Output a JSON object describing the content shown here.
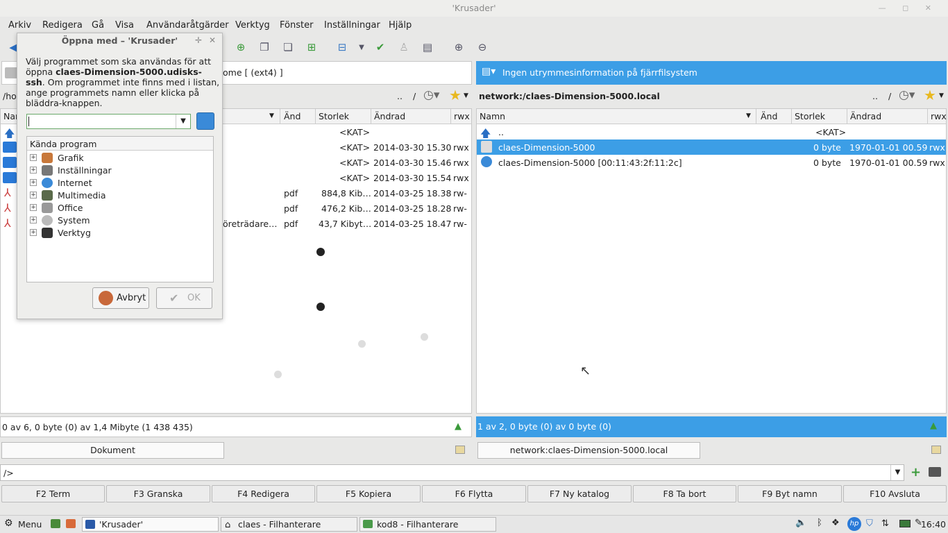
{
  "window": {
    "title": "'Krusader'"
  },
  "menu": [
    "Arkiv",
    "Redigera",
    "Gå",
    "Visa",
    "Användaråtgärder",
    "Verktyg",
    "Fönster",
    "Inställningar",
    "Hjälp"
  ],
  "left": {
    "path": "/ho",
    "disk_info": "ome [ (ext4) ]",
    "nav_up": "..",
    "nav_root": "/",
    "cols": {
      "name": "Nan",
      "ext": "Änd",
      "size": "Storlek",
      "date": "Ändrad",
      "perm": "rwx"
    },
    "rows": [
      {
        "name": "",
        "ext": "",
        "size": "<KAT>",
        "date": "",
        "perm": ""
      },
      {
        "name": "",
        "ext": "",
        "size": "<KAT>",
        "date": "2014-03-30 15.30",
        "perm": "rwx"
      },
      {
        "name": "",
        "ext": "",
        "size": "<KAT>",
        "date": "2014-03-30 15.46",
        "perm": "rwx"
      },
      {
        "name": "",
        "ext": "",
        "size": "<KAT>",
        "date": "2014-03-30 15.54",
        "perm": "rwx"
      },
      {
        "name": "",
        "ext": "pdf",
        "size": "884,8 Kib…",
        "date": "2014-03-25 18.38",
        "perm": "rw-"
      },
      {
        "name": "",
        "ext": "pdf",
        "size": "476,2 Kib…",
        "date": "2014-03-25 18.28",
        "perm": "rw-"
      },
      {
        "name": "öreträdare…",
        "ext": "pdf",
        "size": "43,7 Kibyt…",
        "date": "2014-03-25 18.47",
        "perm": "rw-"
      }
    ],
    "status": "0 av 6, 0 byte (0) av 1,4 Mibyte (1 438 435)",
    "tab": "Dokument"
  },
  "right": {
    "disk_info": "Ingen utrymmesinformation på fjärrfilsystem",
    "path": "network:/claes-Dimension-5000.local",
    "nav_up": "..",
    "nav_root": "/",
    "cols": {
      "name": "Namn",
      "ext": "Änd",
      "size": "Storlek",
      "date": "Ändrad",
      "perm": "rwx"
    },
    "rows": [
      {
        "name": "..",
        "size": "<KAT>",
        "date": "",
        "perm": ""
      },
      {
        "name": "claes-Dimension-5000",
        "size": "0 byte",
        "date": "1970-01-01 00.59",
        "perm": "rwx"
      },
      {
        "name": "claes-Dimension-5000 [00:11:43:2f:11:2c]",
        "size": "0 byte",
        "date": "1970-01-01 00.59",
        "perm": "rwx"
      }
    ],
    "status": "1 av 2, 0 byte (0) av 0 byte (0)",
    "tab": "network:claes-Dimension-5000.local"
  },
  "cmdline": {
    "value": "/>"
  },
  "fkeys": [
    "F2  Term",
    "F3 Granska",
    "F4 Redigera",
    "F5 Kopiera",
    "F6 Flytta",
    "F7 Ny katalog",
    "F8 Ta bort",
    "F9 Byt namn",
    "F10 Avsluta"
  ],
  "dialog": {
    "title": "Öppna med – 'Krusader'",
    "text_pre": "Välj programmet som ska användas för att öppna ",
    "filename": "claes-Dimension-5000.udisks-ssh",
    "text_post": ". Om programmet inte finns med i listan, ange programmets namn eller klicka på bläddra-knappen.",
    "input_value": "",
    "tree_header": "Kända program",
    "categories": [
      "Grafik",
      "Inställningar",
      "Internet",
      "Multimedia",
      "Office",
      "System",
      "Verktyg"
    ],
    "cancel_label": "Avbryt",
    "ok_label": "OK"
  },
  "taskbar": {
    "menu_label": "Menu",
    "tasks": [
      "'Krusader'",
      "claes - Filhanterare",
      "kod8 - Filhanterare"
    ],
    "clock": "16:40"
  },
  "colors": {
    "accent": "#3c9ee6",
    "background": "#e8e8e7"
  }
}
